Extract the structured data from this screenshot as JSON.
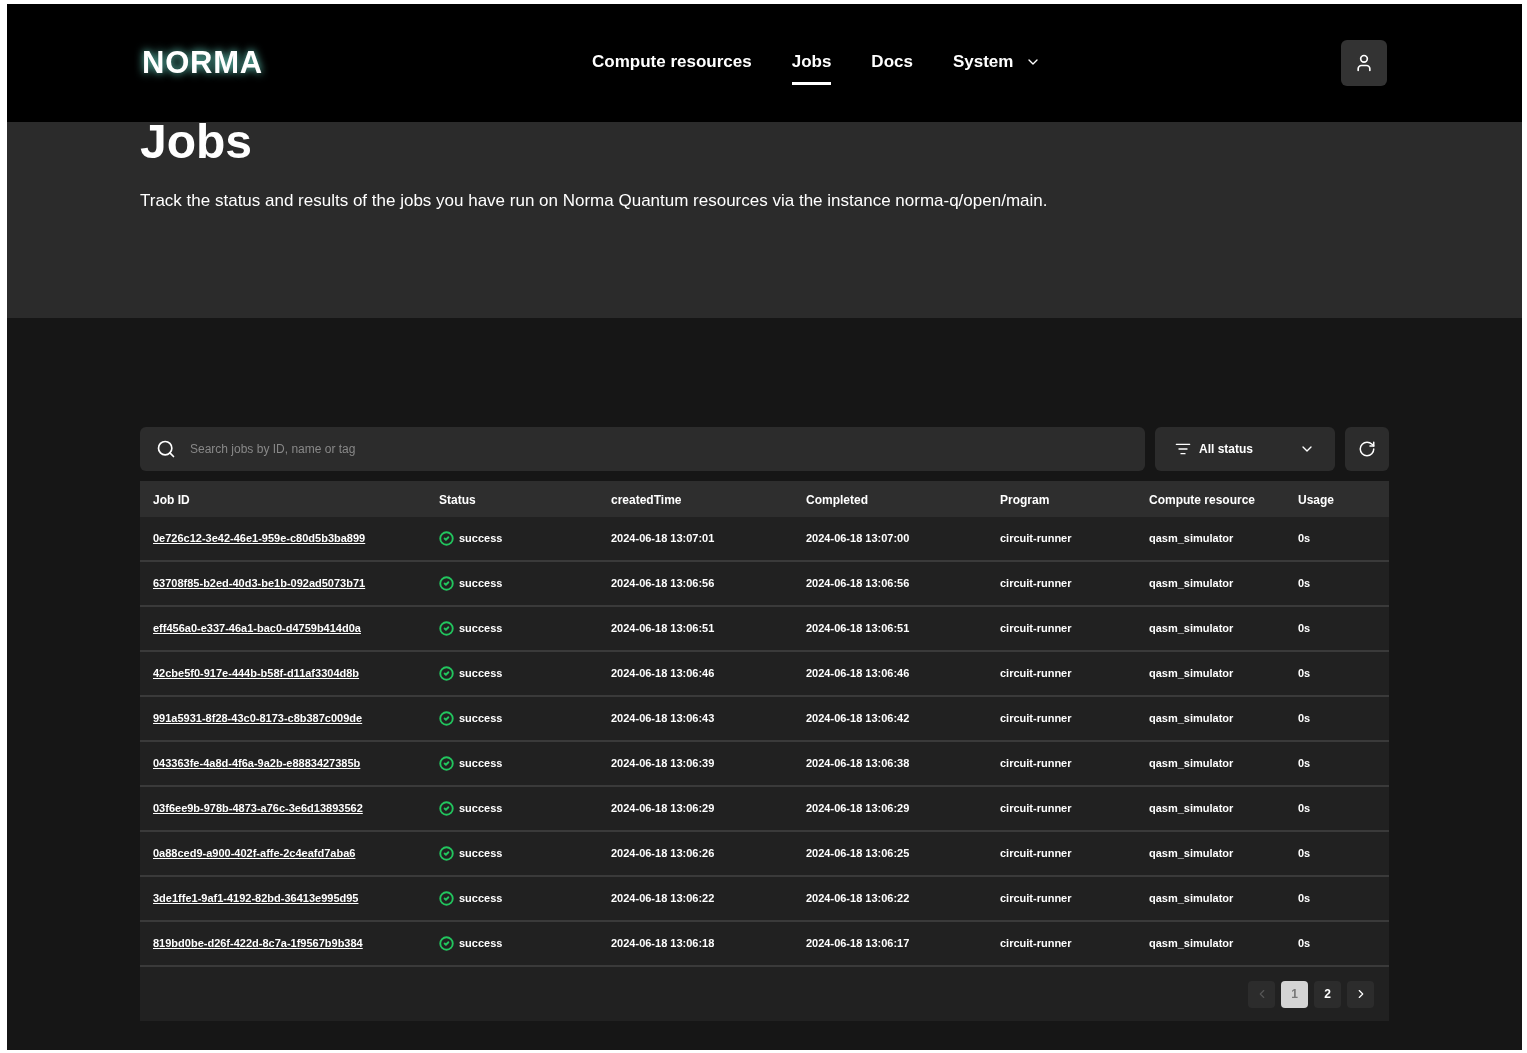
{
  "brand": {
    "logo": "NORMA"
  },
  "nav": [
    {
      "label": "Compute resources",
      "selected": false,
      "dropdown": false
    },
    {
      "label": "Jobs",
      "selected": true,
      "dropdown": false
    },
    {
      "label": "Docs",
      "selected": false,
      "dropdown": false
    },
    {
      "label": "System",
      "selected": false,
      "dropdown": true
    }
  ],
  "page": {
    "title": "Jobs",
    "description": "Track the status and results of the jobs you have run on Norma Quantum resources via the instance norma-q/open/main."
  },
  "search": {
    "placeholder": "Search jobs by ID, name or tag"
  },
  "status_filter": {
    "value": "All status"
  },
  "table": {
    "columns": [
      "Job ID",
      "Status",
      "createdTime",
      "Completed",
      "Program",
      "Compute resource",
      "Usage"
    ],
    "rows": [
      {
        "job_id": "0e726c12-3e42-46e1-959e-c80d5b3ba899",
        "status": "success",
        "color": "#22c55e",
        "created": "2024-06-18 13:07:01",
        "completed": "2024-06-18 13:07:00",
        "program": "circuit-runner",
        "resource": "qasm_simulator",
        "usage": "0s"
      },
      {
        "job_id": "63708f85-b2ed-40d3-be1b-092ad5073b71",
        "status": "success",
        "color": "#22c55e",
        "created": "2024-06-18 13:06:56",
        "completed": "2024-06-18 13:06:56",
        "program": "circuit-runner",
        "resource": "qasm_simulator",
        "usage": "0s"
      },
      {
        "job_id": "eff456a0-e337-46a1-bac0-d4759b414d0a",
        "status": "success",
        "color": "#22c55e",
        "created": "2024-06-18 13:06:51",
        "completed": "2024-06-18 13:06:51",
        "program": "circuit-runner",
        "resource": "qasm_simulator",
        "usage": "0s"
      },
      {
        "job_id": "42cbe5f0-917e-444b-b58f-d11af3304d8b",
        "status": "success",
        "color": "#22c55e",
        "created": "2024-06-18 13:06:46",
        "completed": "2024-06-18 13:06:46",
        "program": "circuit-runner",
        "resource": "qasm_simulator",
        "usage": "0s"
      },
      {
        "job_id": "991a5931-8f28-43c0-8173-c8b387c009de",
        "status": "success",
        "color": "#22c55e",
        "created": "2024-06-18 13:06:43",
        "completed": "2024-06-18 13:06:42",
        "program": "circuit-runner",
        "resource": "qasm_simulator",
        "usage": "0s"
      },
      {
        "job_id": "043363fe-4a8d-4f6a-9a2b-e8883427385b",
        "status": "success",
        "color": "#22c55e",
        "created": "2024-06-18 13:06:39",
        "completed": "2024-06-18 13:06:38",
        "program": "circuit-runner",
        "resource": "qasm_simulator",
        "usage": "0s"
      },
      {
        "job_id": "03f6ee9b-978b-4873-a76c-3e6d13893562",
        "status": "success",
        "color": "#22c55e",
        "created": "2024-06-18 13:06:29",
        "completed": "2024-06-18 13:06:29",
        "program": "circuit-runner",
        "resource": "qasm_simulator",
        "usage": "0s"
      },
      {
        "job_id": "0a88ced9-a900-402f-affe-2c4eafd7aba6",
        "status": "success",
        "color": "#22c55e",
        "created": "2024-06-18 13:06:26",
        "completed": "2024-06-18 13:06:25",
        "program": "circuit-runner",
        "resource": "qasm_simulator",
        "usage": "0s"
      },
      {
        "job_id": "3de1ffe1-9af1-4192-82bd-36413e995d95",
        "status": "success",
        "color": "#22c55e",
        "created": "2024-06-18 13:06:22",
        "completed": "2024-06-18 13:06:22",
        "program": "circuit-runner",
        "resource": "qasm_simulator",
        "usage": "0s"
      },
      {
        "job_id": "819bd0be-d26f-422d-8c7a-1f9567b9b384",
        "status": "success",
        "color": "#22c55e",
        "created": "2024-06-18 13:06:18",
        "completed": "2024-06-18 13:06:17",
        "program": "circuit-runner",
        "resource": "qasm_simulator",
        "usage": "0s"
      }
    ]
  },
  "pagination": {
    "prev_disabled": true,
    "next_disabled": false,
    "pages": [
      {
        "label": "1",
        "selected": true
      },
      {
        "label": "2",
        "selected": false
      }
    ]
  }
}
